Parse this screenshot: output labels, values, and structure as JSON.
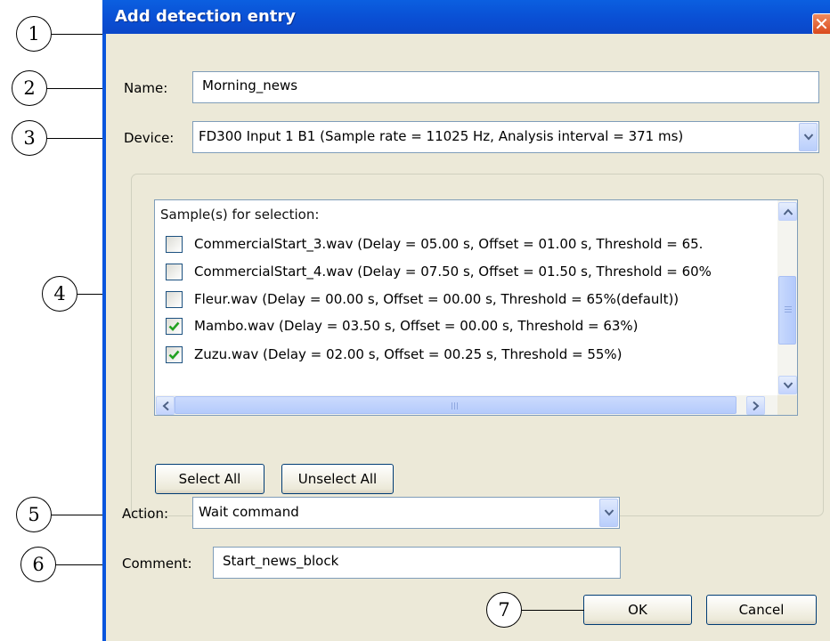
{
  "window": {
    "title": "Add detection entry",
    "close_glyph": "✕"
  },
  "form": {
    "name_label": "Name:",
    "name_value": "Morning_news",
    "device_label": "Device:",
    "device_value": "FD300 Input 1 B1 (Sample rate = 11025 Hz, Analysis interval = 371 ms)",
    "action_label": "Action:",
    "action_value": "Wait command",
    "comment_label": "Comment:",
    "comment_value": "Start_news_block"
  },
  "samples": {
    "header": "Sample(s) for selection:",
    "items": [
      {
        "label": "CommercialStart_3.wav (Delay = 05.00 s, Offset = 01.00 s, Threshold = 65.",
        "checked": false
      },
      {
        "label": "CommercialStart_4.wav (Delay = 07.50 s, Offset = 01.50 s, Threshold = 60%",
        "checked": false
      },
      {
        "label": "Fleur.wav (Delay = 00.00 s, Offset = 00.00 s, Threshold = 65%(default))",
        "checked": false
      },
      {
        "label": "Mambo.wav (Delay = 03.50 s, Offset = 00.00 s, Threshold = 63%)",
        "checked": true
      },
      {
        "label": "Zuzu.wav (Delay = 02.00 s, Offset = 00.25 s, Threshold = 55%)",
        "checked": true
      }
    ],
    "select_all_label": "Select All",
    "unselect_all_label": "Unselect All"
  },
  "buttons": {
    "ok_label": "OK",
    "cancel_label": "Cancel"
  },
  "callouts": [
    "1",
    "2",
    "3",
    "4",
    "5",
    "6",
    "7"
  ],
  "colors": {
    "titlebar": "#0a4fd4",
    "dialog_bg": "#ece9d8",
    "checkmark": "#21a121",
    "close_button": "#e0592a"
  }
}
